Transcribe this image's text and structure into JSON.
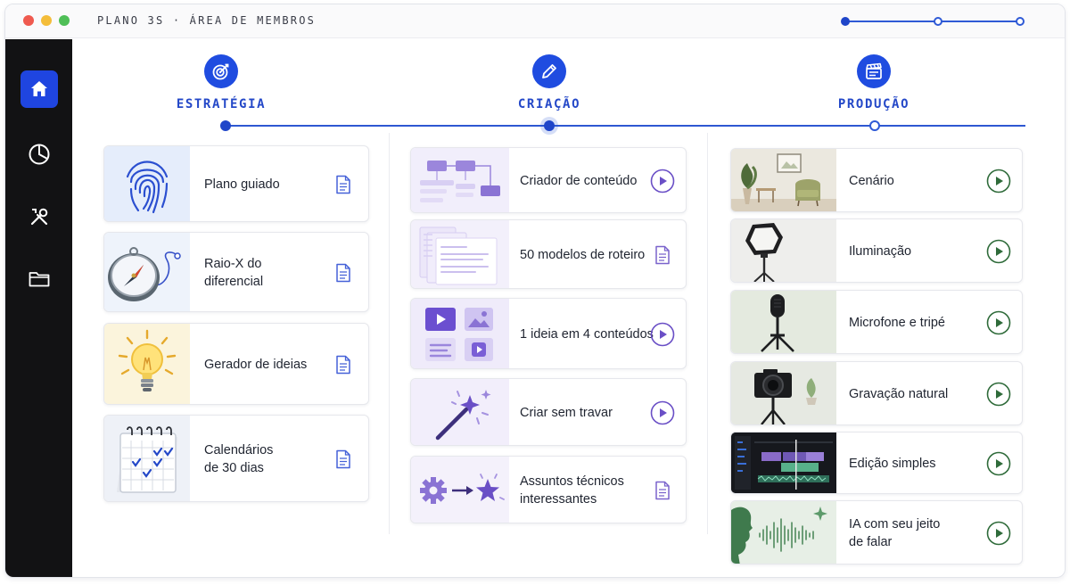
{
  "window": {
    "title": "PLANO 3S · ÁREA DE MEMBROS"
  },
  "colors": {
    "accent": "#1f45e0",
    "purple": "#6a4fc6",
    "green": "#2f6b3a"
  },
  "sidebar": {
    "items": [
      {
        "icon": "home-icon",
        "active": true
      },
      {
        "icon": "pie-chart-icon",
        "active": false
      },
      {
        "icon": "tools-icon",
        "active": false
      },
      {
        "icon": "folder-icon",
        "active": false
      }
    ]
  },
  "steps": [
    {
      "label": "ESTRATÉGIA",
      "icon": "target-icon"
    },
    {
      "label": "CRIAÇÃO",
      "icon": "pencil-icon"
    },
    {
      "label": "PRODUÇÃO",
      "icon": "clapperboard-icon"
    }
  ],
  "estrategia": {
    "cards": [
      {
        "title_lines": [
          "Plano guiado"
        ],
        "action": "document-icon"
      },
      {
        "title_lines": [
          "Raio-X do",
          "diferencial"
        ],
        "action": "document-icon"
      },
      {
        "title_lines": [
          "Gerador de ideias"
        ],
        "action": "document-icon"
      },
      {
        "title_lines": [
          "Calendários",
          "de 30 dias"
        ],
        "action": "document-icon"
      }
    ]
  },
  "criacao": {
    "cards": [
      {
        "title_lines": [
          "Criador de conteúdo"
        ],
        "action": "play-icon"
      },
      {
        "title_lines": [
          "50 modelos de roteiro"
        ],
        "action": "document-icon"
      },
      {
        "title_lines": [
          "1 ideia em 4 conteúdos"
        ],
        "action": "play-icon"
      },
      {
        "title_lines": [
          "Criar sem travar"
        ],
        "action": "play-icon"
      },
      {
        "title_lines": [
          "Assuntos técnicos",
          "interessantes"
        ],
        "action": "document-icon"
      }
    ]
  },
  "producao": {
    "cards": [
      {
        "title_lines": [
          "Cenário"
        ],
        "action": "play-icon"
      },
      {
        "title_lines": [
          "Iluminação"
        ],
        "action": "play-icon"
      },
      {
        "title_lines": [
          "Microfone e tripé"
        ],
        "action": "play-icon"
      },
      {
        "title_lines": [
          "Gravação natural"
        ],
        "action": "play-icon"
      },
      {
        "title_lines": [
          "Edição simples"
        ],
        "action": "play-icon"
      },
      {
        "title_lines": [
          "IA com seu jeito",
          "de falar"
        ],
        "action": "play-icon"
      }
    ]
  }
}
